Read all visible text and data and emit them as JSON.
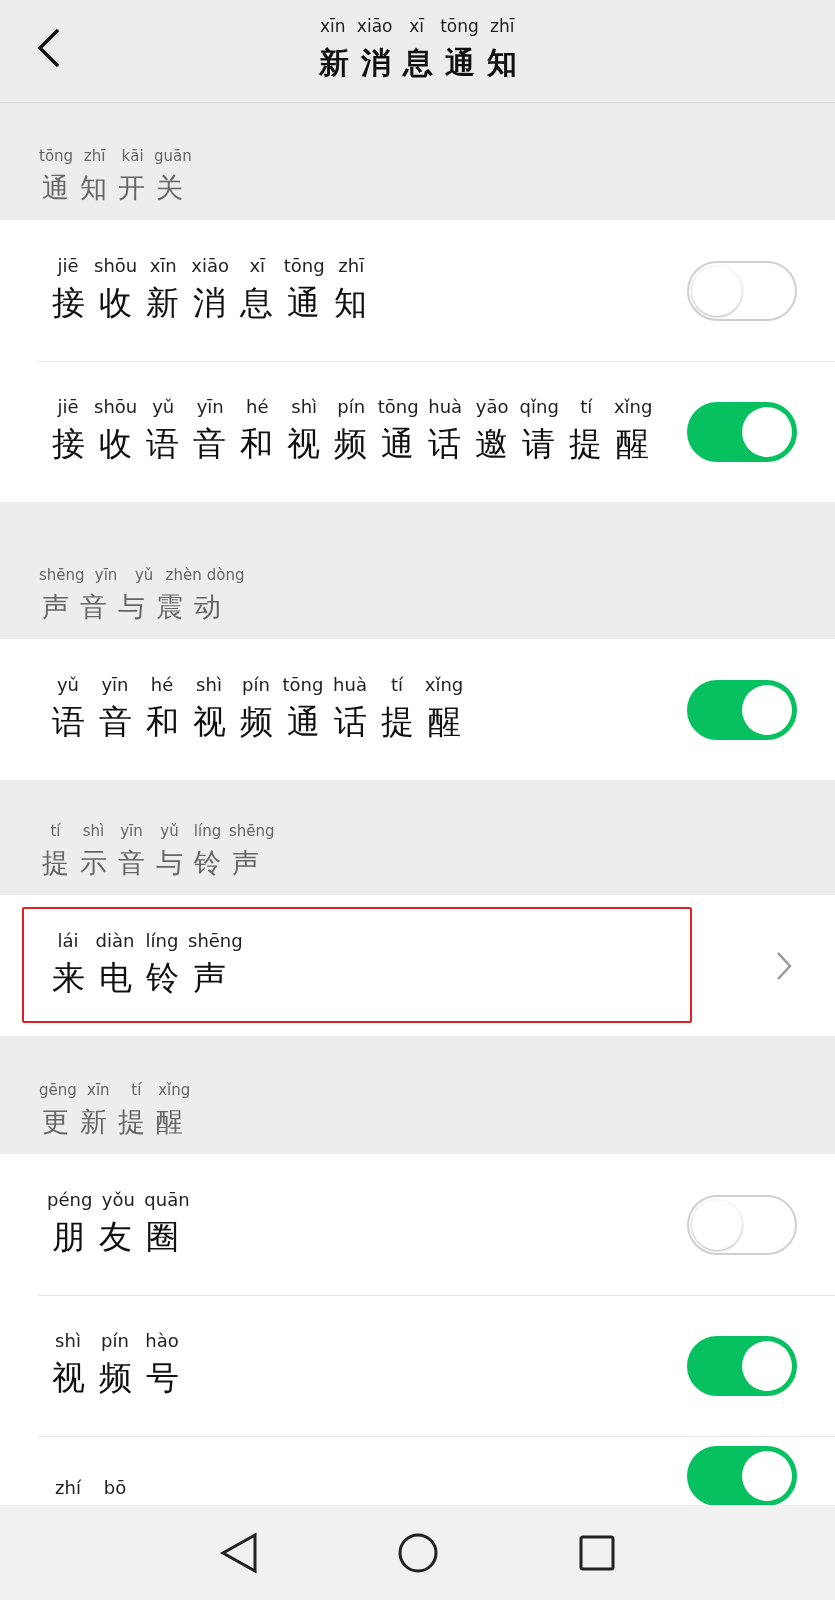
{
  "header": {
    "title": {
      "text": "新消息通知",
      "pinyin": "xīn xiāo xī tōng zhī"
    }
  },
  "sections": [
    {
      "label": {
        "text": "通知开关",
        "pinyin": "tōng zhī kāi guān"
      },
      "rows": [
        {
          "kind": "toggle",
          "text": "接收新消息通知",
          "pinyin": "jiē shōu xīn xiāo xī tōng zhī",
          "on": false
        },
        {
          "kind": "toggle",
          "text": "接收语音和视频通话邀请提醒",
          "pinyin": "jiē shōu yǔ yīn hé shì pín tōng huà yāo qǐng tí xǐng",
          "on": true
        }
      ]
    },
    {
      "label": {
        "text": "声音与震动",
        "pinyin": "shēng yīn yǔ zhèn dòng"
      },
      "rows": [
        {
          "kind": "toggle",
          "text": "语音和视频通话提醒",
          "pinyin": "yǔ yīn hé shì pín tōng huà tí xǐng",
          "on": true
        }
      ]
    },
    {
      "label": {
        "text": "提示音与铃声",
        "pinyin": "tí shì yīn yǔ líng shēng"
      },
      "rows": [
        {
          "kind": "link",
          "text": "来电铃声",
          "pinyin": "lái diàn líng shēng",
          "highlighted": true
        }
      ]
    },
    {
      "label": {
        "text": "更新提醒",
        "pinyin": "gēng xīn tí xǐng"
      },
      "rows": [
        {
          "kind": "toggle",
          "text": "朋友圈",
          "pinyin": "péng yǒu quān",
          "on": false
        },
        {
          "kind": "toggle",
          "text": "视频号",
          "pinyin": "shì pín hào",
          "on": true
        },
        {
          "kind": "toggle",
          "pinyin": "zhí bō",
          "on": true
        }
      ]
    }
  ]
}
